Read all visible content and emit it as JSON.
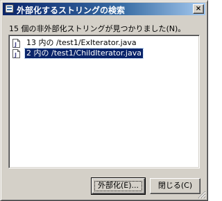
{
  "window": {
    "title": "外部化するストリングの検索"
  },
  "message": "15 個の非外部化ストリングが見つかりました(N)。",
  "results": [
    {
      "label": "13 内の /test1/ExIterator.java",
      "selected": false
    },
    {
      "label": "2 内の /test1/ChildIterator.java",
      "selected": true
    }
  ],
  "buttons": {
    "externalize": "外部化(E)...",
    "close": "閉じる(C)"
  },
  "colors": {
    "selection": "#0a246a",
    "titlebar_start": "#0a246a",
    "face": "#d4d0c8"
  },
  "icons": {
    "title": "eclipse-dialog-icon",
    "file": "java-file-icon",
    "close": "close-icon"
  }
}
